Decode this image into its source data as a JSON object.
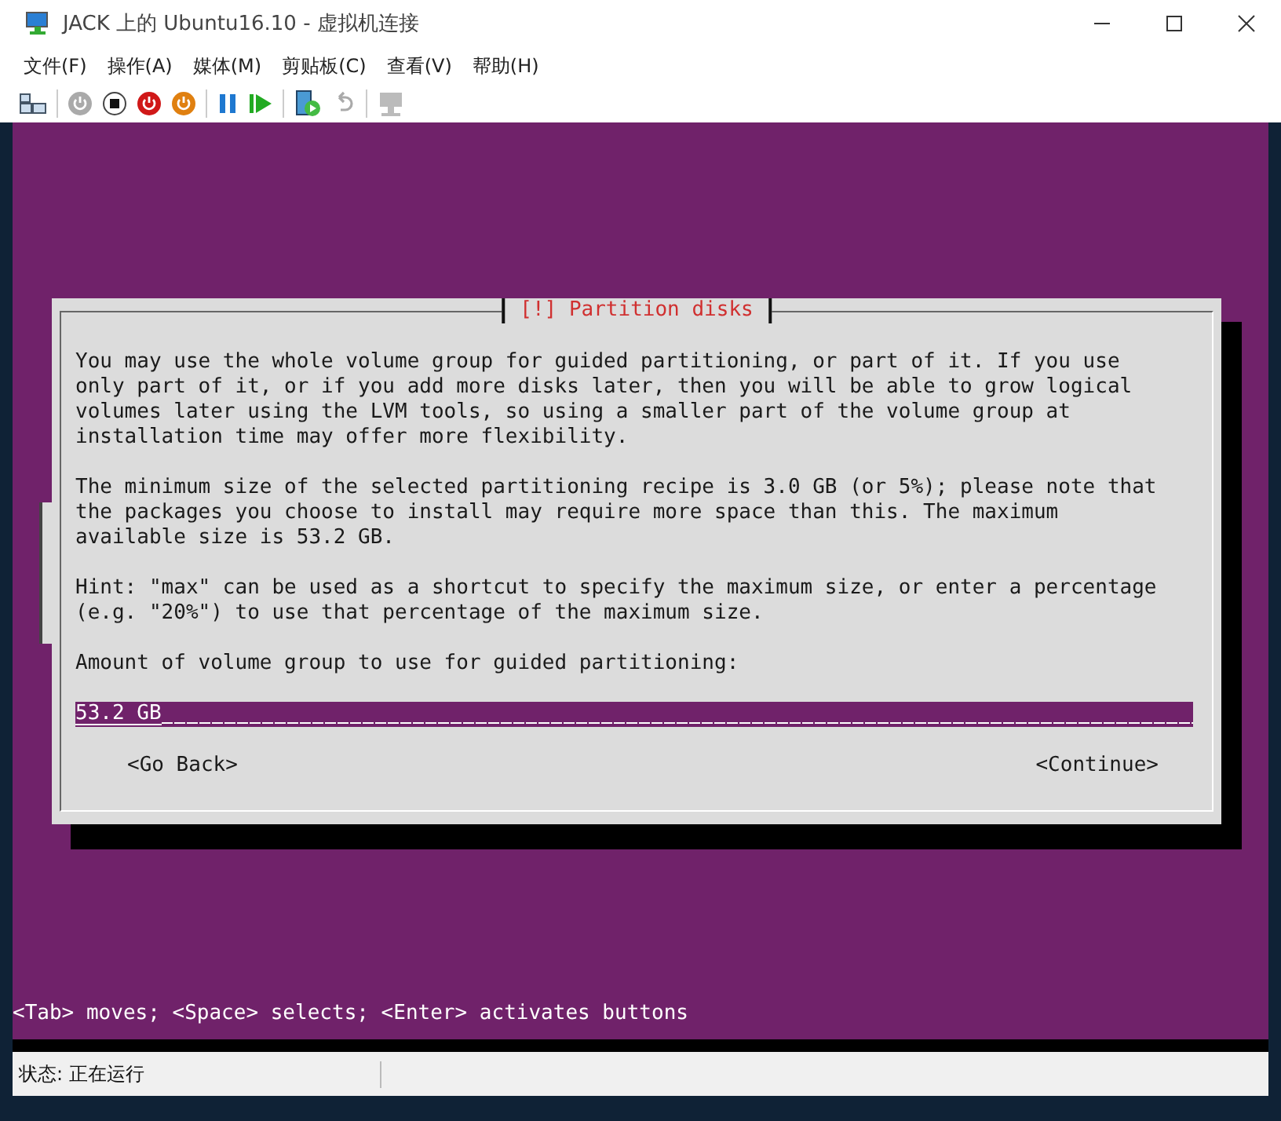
{
  "window": {
    "title": "JACK 上的 Ubuntu16.10 - 虚拟机连接"
  },
  "menu": [
    "文件(F)",
    "操作(A)",
    "媒体(M)",
    "剪贴板(C)",
    "查看(V)",
    "帮助(H)"
  ],
  "dialog": {
    "title": "[!] Partition disks",
    "paragraphs": [
      [
        "You may use the whole volume group for guided partitioning, or part of it. If you use",
        "only part of it, or if you add more disks later, then you will be able to grow logical",
        "volumes later using the LVM tools, so using a smaller part of the volume group at",
        "installation time may offer more flexibility."
      ],
      [
        "The minimum size of the selected partitioning recipe is 3.0 GB (or 5%); please note that",
        "the packages you choose to install may require more space than this. The maximum",
        "available size is 53.2 GB."
      ],
      [
        "Hint: \"max\" can be used as a shortcut to specify the maximum size, or enter a percentage",
        "(e.g. \"20%\") to use that percentage of the maximum size."
      ],
      [
        "Amount of volume group to use for guided partitioning:"
      ]
    ],
    "input": {
      "value": "53.2 GB"
    },
    "buttons": [
      "<Go Back>",
      "<Continue>"
    ]
  },
  "console_hint": "<Tab> moves; <Space> selects; <Enter> activates buttons",
  "status_bar": "状态: 正在运行"
}
